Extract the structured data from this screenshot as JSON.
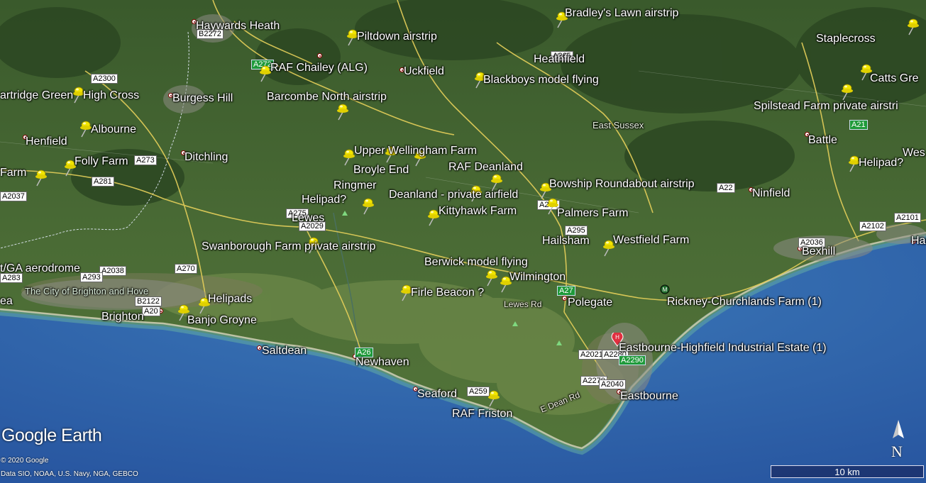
{
  "map": {
    "attribution": {
      "logo": "Google Earth",
      "copyright": "© 2020 Google",
      "credits": "Data SIO, NOAA, U.S. Navy, NGA, GEBCO"
    },
    "scale": {
      "label": "10 km"
    },
    "compass": {
      "label": "N"
    },
    "icons": {
      "pushpin": "pushpin-icon",
      "place": "place-dot-icon",
      "hospital": "hospital-icon",
      "motorway": "motorway-junction-icon",
      "peak": "peak-icon"
    },
    "colors": {
      "pin_yellow": "#f2e600",
      "sea": "#2f66a6",
      "land": "#3e5e2e",
      "road_yellow": "#e8d060",
      "label_text": "#ffffff"
    },
    "pins": [
      "Piltdown airstrip",
      "Bradley's Lawn airstrip",
      "RAF Chailey (ALG)",
      "Blackboys model flying",
      "Barcombe North airstrip",
      "artridge Green",
      "Albourne",
      "Folly Farm",
      "Farm",
      "Upper Wellingham Farm",
      "RAF Deanland",
      "Bowship Roundabout airstrip",
      "Deanland -  private airfield",
      "Helipad?",
      "Kittyhawk Farm",
      "Palmers Farm",
      "Westfield Farm",
      "Swanborough Farm private airstrip",
      "Berwick model flying",
      "Wilmington",
      "Firle Beacon ?",
      "Helipads",
      "Banjo Groyne",
      "RAF Friston",
      "Catts Green",
      "Spilstead Farm private airstrip",
      "Helipad?",
      "Staplecross pin"
    ],
    "labels": [
      "Haywards Heath",
      "Piltdown airstrip",
      "Bradley's Lawn airstrip",
      "Staplecross",
      "Heathfield",
      "RAF Chailey (ALG)",
      "Uckfield",
      "Blackboys model flying",
      "Catts Gre",
      "artridge Green",
      "High Cross",
      "Burgess Hill",
      "Barcombe North airstrip",
      "Spilstead Farm private airstri",
      "East Sussex",
      "Albourne",
      "Henfield",
      "Battle",
      "Wes",
      "Folly Farm",
      "Ditchling",
      "Upper Wellingham Farm",
      "Farm",
      "Broyle End",
      "RAF Deanland",
      "Helipad?",
      "Ringmer",
      "Deanland -  private airfield",
      "Bowship Roundabout airstrip",
      "Ninfield",
      "Helipad?",
      "Lewes",
      "Kittyhawk Farm",
      "Palmers Farm",
      "Hailsham",
      "Westfield Farm",
      "Swanborough Farm private airstrip",
      "Bexhill",
      "Has",
      "Berwick model flying",
      "t/GA aerodrome",
      "Wilmington",
      "The City of Brighton and Hove",
      "Firle Beacon ?",
      "Lewes Rd",
      "Polegate",
      "Rickney-Churchlands Farm (1)",
      "ea",
      "Helipads",
      "Brighton",
      "Banjo Groyne",
      "Eastbourne-Highfield Industrial Estate (1)",
      "Saltdean",
      "Newhaven",
      "Seaford",
      "Eastbourne",
      "RAF Friston",
      "E Dean Rd"
    ],
    "roads": [
      "B2272",
      "A272",
      "A265",
      "A2300",
      "A21",
      "A273",
      "A281",
      "A2037",
      "A275",
      "A2029",
      "A27",
      "A274",
      "A22",
      "A295",
      "A2036",
      "A2101",
      "A2102",
      "A2038",
      "A270",
      "A293",
      "B2122",
      "A20",
      "A26",
      "A2021",
      "A2280",
      "A2290",
      "A259",
      "A2270",
      "A2040",
      "A283"
    ]
  }
}
